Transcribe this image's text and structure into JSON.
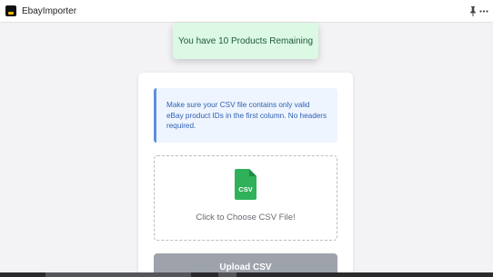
{
  "window": {
    "title": "EbayImporter",
    "icons": [
      "app-logo",
      "pin-icon",
      "more-icon"
    ]
  },
  "toast": {
    "message": "You have 10 Products Remaining",
    "color": "#dcf9e6"
  },
  "card": {
    "info_message": "Make sure your CSV file contains only valid eBay product IDs in the first column. No headers required.",
    "file_icon_label": "CSV",
    "dropzone_label": "Click to Choose CSV File!",
    "upload_button_label": "Upload CSV"
  },
  "colors": {
    "accent_info": "#5f8fdc",
    "csv_icon": "#2fb15a",
    "upload_disabled": "#9ea3ab"
  }
}
